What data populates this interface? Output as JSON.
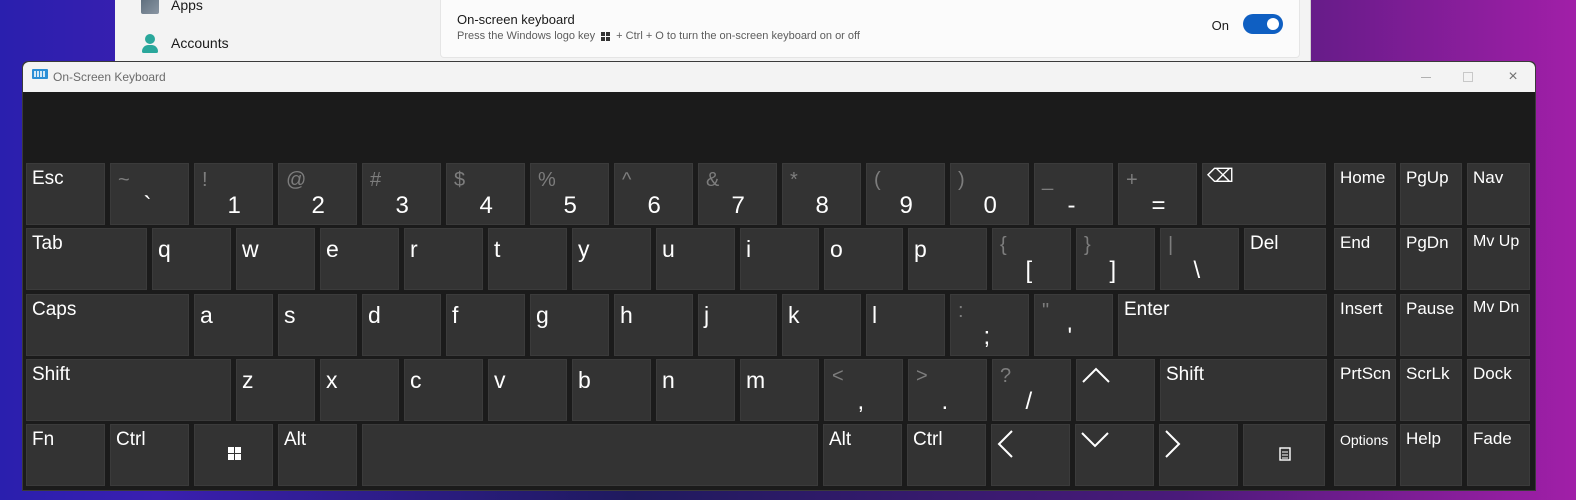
{
  "settings": {
    "nav": [
      {
        "label": "Apps",
        "icon": "apps-icon"
      },
      {
        "label": "Accounts",
        "icon": "accounts-icon"
      }
    ],
    "onscreen": {
      "title": "On-screen keyboard",
      "desc_before": "Press the Windows logo key",
      "desc_after": "+ Ctrl + O to turn the on-screen keyboard on or off",
      "toggle_label": "On",
      "toggle_on": true
    }
  },
  "osk": {
    "title": "On-Screen Keyboard",
    "controls": {
      "minimize": "minimize-icon",
      "maximize": "maximize-icon",
      "close": "×"
    },
    "rows": {
      "r1": [
        {
          "id": "esc",
          "label": "Esc"
        },
        {
          "id": "backtick",
          "shift": "~",
          "main": "`"
        },
        {
          "id": "1",
          "shift": "!",
          "main": "1"
        },
        {
          "id": "2",
          "shift": "@",
          "main": "2"
        },
        {
          "id": "3",
          "shift": "#",
          "main": "3"
        },
        {
          "id": "4",
          "shift": "$",
          "main": "4"
        },
        {
          "id": "5",
          "shift": "%",
          "main": "5"
        },
        {
          "id": "6",
          "shift": "^",
          "main": "6"
        },
        {
          "id": "7",
          "shift": "&",
          "main": "7"
        },
        {
          "id": "8",
          "shift": "*",
          "main": "8"
        },
        {
          "id": "9",
          "shift": "(",
          "main": "9"
        },
        {
          "id": "0",
          "shift": ")",
          "main": "0"
        },
        {
          "id": "minus",
          "shift": "_",
          "main": "-"
        },
        {
          "id": "equals",
          "shift": "+",
          "main": "="
        },
        {
          "id": "backspace",
          "label": "⌫"
        }
      ],
      "r2": [
        {
          "id": "tab",
          "label": "Tab"
        },
        {
          "id": "q",
          "main": "q"
        },
        {
          "id": "w",
          "main": "w"
        },
        {
          "id": "e",
          "main": "e"
        },
        {
          "id": "r",
          "main": "r"
        },
        {
          "id": "t",
          "main": "t"
        },
        {
          "id": "y",
          "main": "y"
        },
        {
          "id": "u",
          "main": "u"
        },
        {
          "id": "i",
          "main": "i"
        },
        {
          "id": "o",
          "main": "o"
        },
        {
          "id": "p",
          "main": "p"
        },
        {
          "id": "lbracket",
          "shift": "{",
          "main": "["
        },
        {
          "id": "rbracket",
          "shift": "}",
          "main": "]"
        },
        {
          "id": "backslash",
          "shift": "|",
          "main": "\\"
        },
        {
          "id": "del",
          "label": "Del"
        }
      ],
      "r3": [
        {
          "id": "caps",
          "label": "Caps"
        },
        {
          "id": "a",
          "main": "a"
        },
        {
          "id": "s",
          "main": "s"
        },
        {
          "id": "d",
          "main": "d"
        },
        {
          "id": "f",
          "main": "f"
        },
        {
          "id": "g",
          "main": "g"
        },
        {
          "id": "h",
          "main": "h"
        },
        {
          "id": "j",
          "main": "j"
        },
        {
          "id": "k",
          "main": "k"
        },
        {
          "id": "l",
          "main": "l"
        },
        {
          "id": "semicolon",
          "shift": ":",
          "main": ";"
        },
        {
          "id": "quote",
          "shift": "\"",
          "main": "'"
        },
        {
          "id": "enter",
          "label": "Enter"
        }
      ],
      "r4": [
        {
          "id": "lshift",
          "label": "Shift"
        },
        {
          "id": "z",
          "main": "z"
        },
        {
          "id": "x",
          "main": "x"
        },
        {
          "id": "c",
          "main": "c"
        },
        {
          "id": "v",
          "main": "v"
        },
        {
          "id": "b",
          "main": "b"
        },
        {
          "id": "n",
          "main": "n"
        },
        {
          "id": "m",
          "main": "m"
        },
        {
          "id": "comma",
          "shift": "<",
          "main": ","
        },
        {
          "id": "period",
          "shift": ">",
          "main": "."
        },
        {
          "id": "slash",
          "shift": "?",
          "main": "/"
        },
        {
          "id": "up",
          "label": "up-arrow"
        },
        {
          "id": "rshift",
          "label": "Shift"
        }
      ],
      "r5": [
        {
          "id": "fn",
          "label": "Fn"
        },
        {
          "id": "lctrl",
          "label": "Ctrl"
        },
        {
          "id": "win",
          "label": "windows-icon"
        },
        {
          "id": "lalt",
          "label": "Alt"
        },
        {
          "id": "space",
          "label": ""
        },
        {
          "id": "ralt",
          "label": "Alt"
        },
        {
          "id": "rctrl",
          "label": "Ctrl"
        },
        {
          "id": "left",
          "label": "left-arrow"
        },
        {
          "id": "down",
          "label": "down-arrow"
        },
        {
          "id": "right",
          "label": "right-arrow"
        },
        {
          "id": "menu",
          "label": "menu-icon"
        }
      ]
    },
    "side": [
      [
        "Home",
        "PgUp",
        "Nav"
      ],
      [
        "End",
        "PgDn",
        "Mv Up"
      ],
      [
        "Insert",
        "Pause",
        "Mv Dn"
      ],
      [
        "PrtScn",
        "ScrLk",
        "Dock"
      ],
      [
        "Options",
        "Help",
        "Fade"
      ]
    ]
  }
}
